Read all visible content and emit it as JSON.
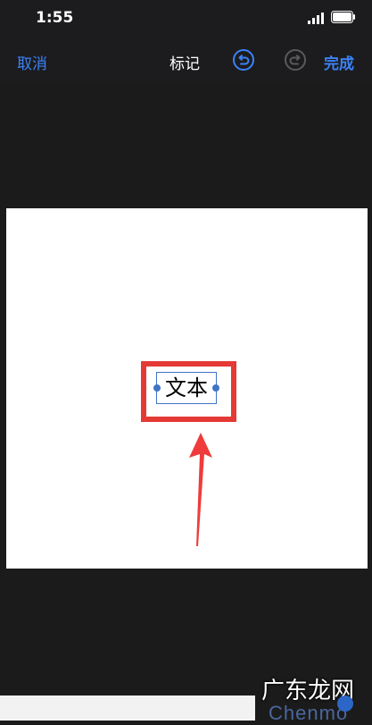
{
  "status": {
    "time": "1:55"
  },
  "nav": {
    "cancel_label": "取消",
    "title": "标记",
    "done_label": "完成"
  },
  "canvas": {
    "text_box": "文本"
  },
  "watermark": {
    "text": "广东龙网",
    "subtext": "Chenmo"
  },
  "icons": {
    "status": [
      "signal-icon",
      "battery-icon"
    ],
    "toolbar": [
      "undo-icon",
      "redo-icon"
    ],
    "annotation": [
      "highlight-box",
      "arrow-annotation"
    ]
  },
  "colors": {
    "accent": "#3b82f6",
    "highlight": "#e53935",
    "selection": "#3f75c4",
    "background": "#1b1b1b"
  }
}
